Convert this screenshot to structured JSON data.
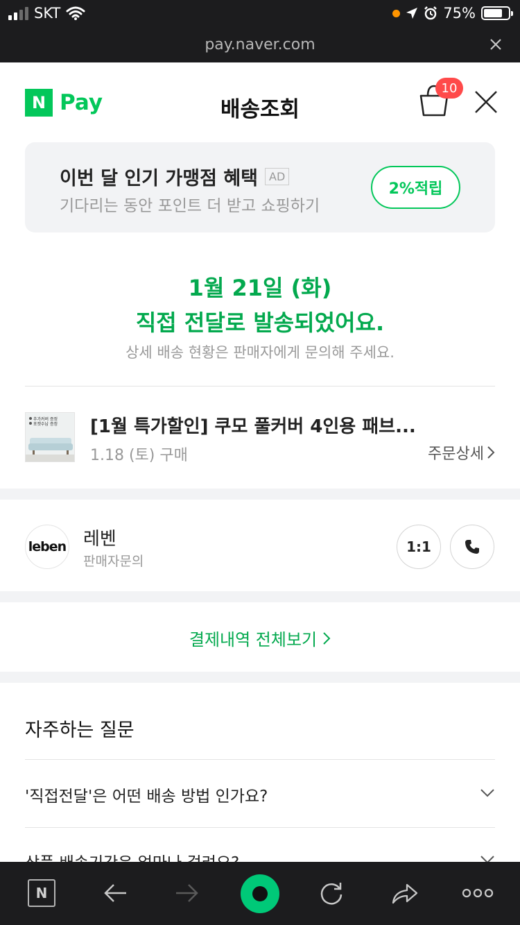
{
  "status_bar": {
    "carrier": "SKT",
    "battery": "75%"
  },
  "browser": {
    "url": "pay.naver.com"
  },
  "header": {
    "brand_logo": "N",
    "brand_text": "Pay",
    "title": "배송조회",
    "cart_count": "10"
  },
  "ad": {
    "title": "이번 달 인기 가맹점 혜택",
    "tag": "AD",
    "subtitle": "기다리는 동안 포인트 더 받고 쇼핑하기",
    "button": "2%적립"
  },
  "delivery": {
    "date": "1월 21일 (화)",
    "status": "직접 전달로 발송되었어요.",
    "note": "상세 배송 현황은 판매자에게 문의해 주세요."
  },
  "product": {
    "name": "[1월 특가할인] 쿠모 풀커버 4인용 패브...",
    "purchase_date": "1.18 (토) 구매",
    "detail_link": "주문상세",
    "thumb_line1": "추가커버 증정",
    "thumb_line2": "포켓수납 증정"
  },
  "seller": {
    "logo_text": "leben",
    "name": "레벤",
    "subtitle": "판매자문의",
    "chat_button": "1:1"
  },
  "payments": {
    "link": "결제내역 전체보기"
  },
  "faq": {
    "title": "자주하는 질문",
    "items": [
      {
        "question": "'직접전달'은 어떤 배송 방법 인가요?"
      },
      {
        "question": "상품 배송기간은 얼마나 걸려요?"
      }
    ]
  },
  "toolbar": {
    "home_label": "N"
  },
  "colors": {
    "brand_green": "#03c75a",
    "status_green": "#03a94e",
    "badge_red": "#ff4a4a",
    "dark_bar": "#1c1c1e"
  }
}
